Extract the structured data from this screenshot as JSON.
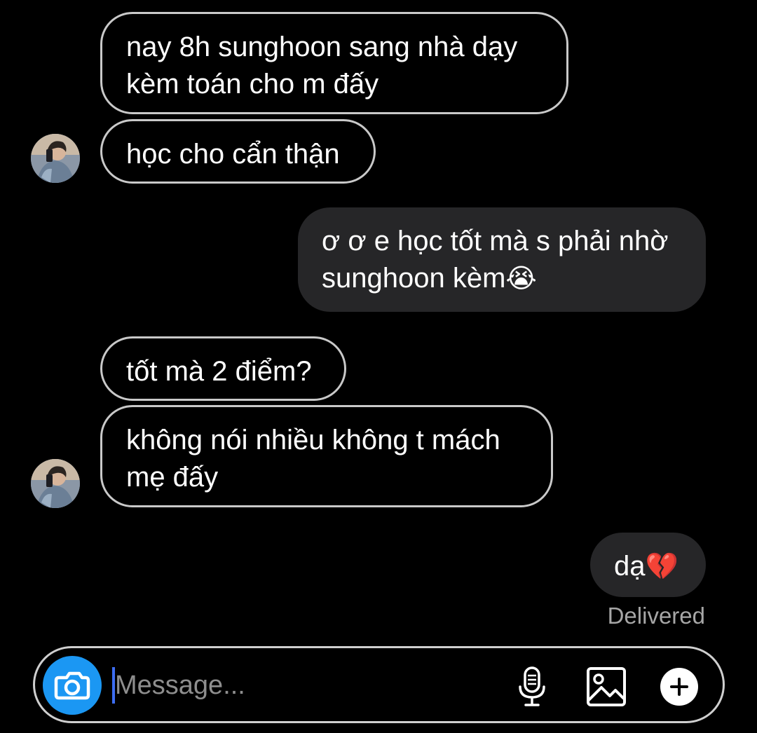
{
  "messages": [
    {
      "id": "m1",
      "sender": "other",
      "lines": [
        "nay 8h sunghoon sang nhà dạy",
        "kèm toán cho m đấy"
      ]
    },
    {
      "id": "m2",
      "sender": "other",
      "lines": [
        "học cho cẩn thận"
      ]
    },
    {
      "id": "m3",
      "sender": "me",
      "lines": [
        "ơ ơ e học tốt mà s phải nhờ",
        "sunghoon kèm"
      ],
      "emoji": "😭"
    },
    {
      "id": "m4",
      "sender": "other",
      "lines": [
        "tốt mà 2 điểm?"
      ]
    },
    {
      "id": "m5",
      "sender": "other",
      "lines": [
        "không nói nhiều không t mách",
        "mẹ đấy"
      ]
    },
    {
      "id": "m6",
      "sender": "me",
      "lines": [
        "dạ"
      ],
      "emoji": "💔"
    }
  ],
  "status": {
    "delivered": "Delivered"
  },
  "composer": {
    "placeholder": "Message...",
    "value": ""
  },
  "icons": {
    "camera": "camera-icon",
    "mic": "microphone-icon",
    "photo": "image-icon",
    "plus": "plus-icon"
  },
  "colors": {
    "background": "#000000",
    "incoming_border": "#c9c9c9",
    "outgoing_bubble": "#262628",
    "accent": "#1b97f3",
    "caret": "#3d6df2",
    "meta_text": "#a6a6a6"
  }
}
